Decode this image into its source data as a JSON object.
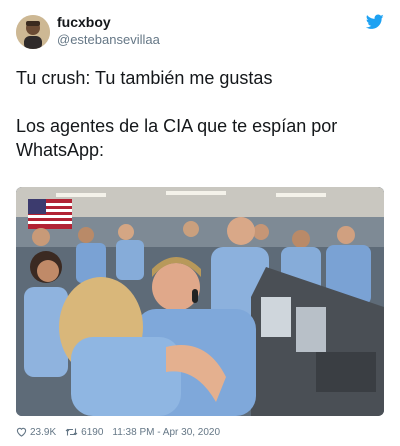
{
  "author": {
    "display_name": "fucxboy",
    "handle": "@estebansevillaa"
  },
  "tweet": {
    "lines": [
      "Tu crush: Tu también me gustas",
      "Los agentes de la CIA que te espían por WhatsApp:"
    ]
  },
  "media": {
    "description_icon": "photo"
  },
  "stats": {
    "likes": "23.9K",
    "retweets": "6190",
    "timestamp": "11:38 PM - Apr 30, 2020"
  },
  "icons": {
    "brand": "twitter-bird-icon",
    "like": "heart-icon",
    "retweet": "retweet-icon"
  },
  "colors": {
    "brand": "#1da1f2",
    "text": "#14171a",
    "secondary": "#657786"
  }
}
